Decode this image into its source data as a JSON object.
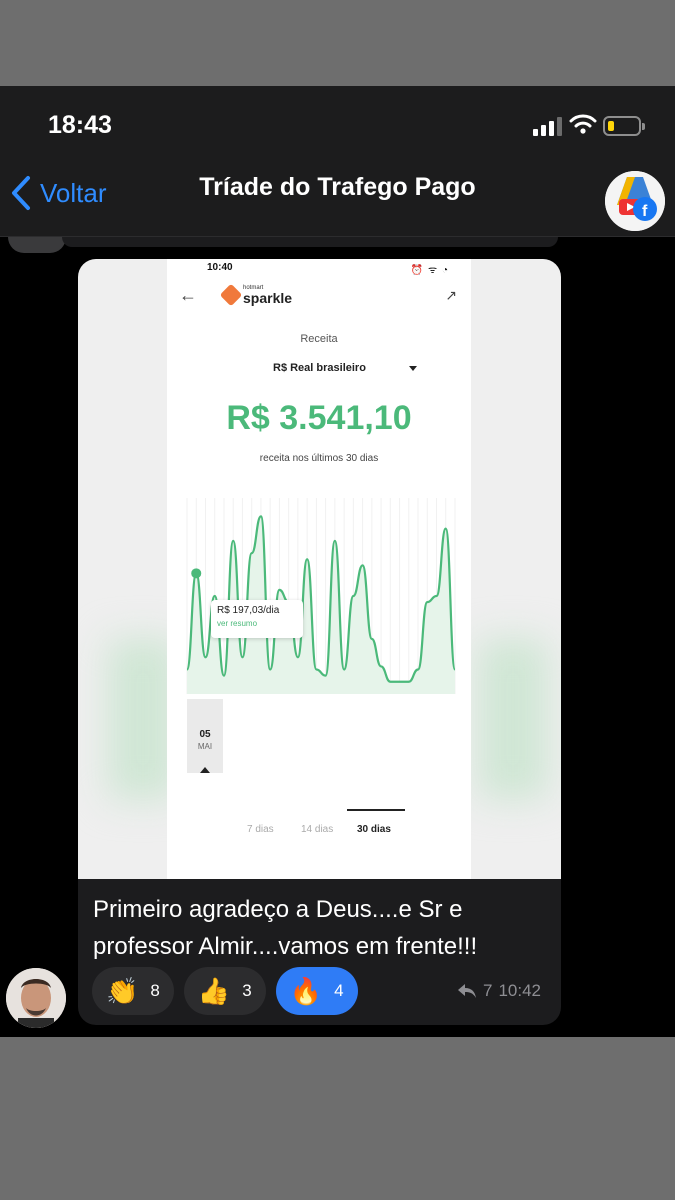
{
  "status_bar": {
    "time": "18:43"
  },
  "nav": {
    "back_label": "Voltar",
    "title": "Tríade do Trafego Pago"
  },
  "message": {
    "photo": {
      "status_time": "10:40",
      "status_icons": "⏰ ᯤ ◔",
      "brand_small": "hotmart",
      "brand_big": "sparkle",
      "receita_label": "Receita",
      "currency_select": "R$ Real brasileiro",
      "amount": "R$ 3.541,10",
      "amount_sub": "receita nos últimos 30 dias",
      "tooltip_value": "R$ 197,03/dia",
      "tooltip_link": "ver resumo",
      "x_day": "05",
      "x_month": "MAI",
      "tabs": [
        {
          "label": "7 dias",
          "active": false
        },
        {
          "label": "14 dias",
          "active": false
        },
        {
          "label": "30 dias",
          "active": true
        }
      ]
    },
    "text": "Primeiro agradeço a Deus....e Sr e professor Almir....vamos em frente!!!",
    "reactions": [
      {
        "emoji": "👏",
        "count": "8",
        "active": false
      },
      {
        "emoji": "👍",
        "count": "3",
        "active": false
      },
      {
        "emoji": "🔥",
        "count": "4",
        "active": true
      }
    ],
    "replies": "7",
    "time": "10:42"
  },
  "colors": {
    "accent": "#2f8cff",
    "revenue_green": "#4bb97a",
    "bubble": "#1c1c1e"
  },
  "chart_data": {
    "type": "line",
    "x": [
      1,
      2,
      3,
      4,
      5,
      6,
      7,
      8,
      9,
      10,
      11,
      12,
      13,
      14,
      15,
      16,
      17,
      18,
      19,
      20,
      21,
      22,
      23,
      24,
      25,
      26,
      27,
      28,
      29,
      30
    ],
    "series": [
      {
        "values": [
          40,
          197,
          60,
          160,
          30,
          250,
          60,
          230,
          290,
          40,
          170,
          150,
          60,
          220,
          40,
          30,
          250,
          40,
          160,
          210,
          90,
          45,
          20,
          20,
          20,
          40,
          150,
          160,
          270,
          40
        ]
      }
    ],
    "ylim": [
      0,
      320
    ],
    "xlabel": "",
    "ylabel": "",
    "grid": true
  }
}
